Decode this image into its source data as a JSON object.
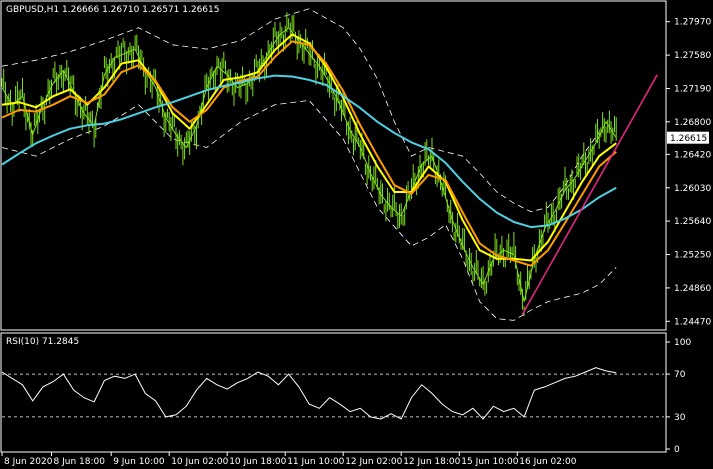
{
  "chart_data": {
    "type": "line",
    "main_panel": {
      "header": "GBPUSD,H1  1.26666 1.26710 1.26571 1.26615",
      "y_ticks": [
        "1.27970",
        "1.27580",
        "1.27190",
        "1.26800",
        "1.26420",
        "1.26030",
        "1.25640",
        "1.25250",
        "1.24860",
        "1.24470"
      ],
      "y_tick_values": [
        1.2797,
        1.2758,
        1.2719,
        1.268,
        1.2642,
        1.2603,
        1.2564,
        1.2525,
        1.2486,
        1.2447
      ],
      "ylim": [
        1.2438,
        1.282
      ],
      "current_price_label": "1.26615",
      "current_price": 1.26615,
      "price_series": [
        [
          0,
          1.272
        ],
        [
          6,
          1.27
        ],
        [
          12,
          1.271
        ],
        [
          18,
          1.2665
        ],
        [
          24,
          1.27
        ],
        [
          30,
          1.2725
        ],
        [
          36,
          1.274
        ],
        [
          42,
          1.2715
        ],
        [
          48,
          1.269
        ],
        [
          54,
          1.2675
        ],
        [
          60,
          1.2735
        ],
        [
          66,
          1.2755
        ],
        [
          72,
          1.276
        ],
        [
          78,
          1.2765
        ],
        [
          84,
          1.274
        ],
        [
          90,
          1.272
        ],
        [
          96,
          1.2685
        ],
        [
          102,
          1.2665
        ],
        [
          108,
          1.265
        ],
        [
          114,
          1.2675
        ],
        [
          120,
          1.272
        ],
        [
          126,
          1.2745
        ],
        [
          132,
          1.2735
        ],
        [
          138,
          1.272
        ],
        [
          144,
          1.2725
        ],
        [
          150,
          1.274
        ],
        [
          156,
          1.276
        ],
        [
          162,
          1.278
        ],
        [
          168,
          1.279
        ],
        [
          174,
          1.2775
        ],
        [
          180,
          1.276
        ],
        [
          186,
          1.2745
        ],
        [
          192,
          1.2725
        ],
        [
          198,
          1.27
        ],
        [
          204,
          1.267
        ],
        [
          210,
          1.265
        ],
        [
          216,
          1.262
        ],
        [
          222,
          1.2595
        ],
        [
          228,
          1.258
        ],
        [
          234,
          1.257
        ],
        [
          240,
          1.26
        ],
        [
          246,
          1.263
        ],
        [
          252,
          1.264
        ],
        [
          258,
          1.2605
        ],
        [
          264,
          1.2565
        ],
        [
          270,
          1.2535
        ],
        [
          276,
          1.251
        ],
        [
          282,
          1.249
        ],
        [
          288,
          1.252
        ],
        [
          294,
          1.253
        ],
        [
          300,
          1.2525
        ],
        [
          306,
          1.247
        ],
        [
          312,
          1.252
        ],
        [
          318,
          1.2555
        ],
        [
          324,
          1.2575
        ],
        [
          330,
          1.26
        ],
        [
          336,
          1.2615
        ],
        [
          342,
          1.2635
        ],
        [
          348,
          1.2655
        ],
        [
          354,
          1.268
        ],
        [
          360,
          1.26615
        ]
      ],
      "series": [
        {
          "name": "ma_fast",
          "color": "#ffff00",
          "points": [
            [
              0,
              1.27
            ],
            [
              10,
              1.2703
            ],
            [
              20,
              1.2697
            ],
            [
              30,
              1.271
            ],
            [
              40,
              1.2718
            ],
            [
              50,
              1.27
            ],
            [
              60,
              1.272
            ],
            [
              70,
              1.2748
            ],
            [
              80,
              1.2752
            ],
            [
              90,
              1.2727
            ],
            [
              100,
              1.269
            ],
            [
              110,
              1.2672
            ],
            [
              120,
              1.27
            ],
            [
              130,
              1.2729
            ],
            [
              140,
              1.2732
            ],
            [
              150,
              1.2738
            ],
            [
              160,
              1.2764
            ],
            [
              170,
              1.2782
            ],
            [
              180,
              1.2772
            ],
            [
              190,
              1.2744
            ],
            [
              200,
              1.2708
            ],
            [
              210,
              1.2665
            ],
            [
              220,
              1.2628
            ],
            [
              230,
              1.2598
            ],
            [
              240,
              1.2598
            ],
            [
              250,
              1.2628
            ],
            [
              260,
              1.261
            ],
            [
              270,
              1.2565
            ],
            [
              280,
              1.253
            ],
            [
              290,
              1.252
            ],
            [
              300,
              1.252
            ],
            [
              310,
              1.2518
            ],
            [
              320,
              1.254
            ],
            [
              330,
              1.2575
            ],
            [
              340,
              1.261
            ],
            [
              350,
              1.264
            ],
            [
              360,
              1.2655
            ]
          ]
        },
        {
          "name": "ma_medium",
          "color": "#ff9900",
          "points": [
            [
              0,
              1.2685
            ],
            [
              10,
              1.2694
            ],
            [
              20,
              1.2692
            ],
            [
              30,
              1.27
            ],
            [
              40,
              1.271
            ],
            [
              50,
              1.2702
            ],
            [
              60,
              1.2712
            ],
            [
              70,
              1.2738
            ],
            [
              80,
              1.2746
            ],
            [
              90,
              1.2728
            ],
            [
              100,
              1.2697
            ],
            [
              110,
              1.268
            ],
            [
              120,
              1.2694
            ],
            [
              130,
              1.272
            ],
            [
              140,
              1.2728
            ],
            [
              150,
              1.2733
            ],
            [
              160,
              1.2756
            ],
            [
              170,
              1.2774
            ],
            [
              180,
              1.277
            ],
            [
              190,
              1.2748
            ],
            [
              200,
              1.2716
            ],
            [
              210,
              1.2676
            ],
            [
              220,
              1.264
            ],
            [
              230,
              1.2606
            ],
            [
              240,
              1.2596
            ],
            [
              250,
              1.2618
            ],
            [
              260,
              1.2612
            ],
            [
              270,
              1.2574
            ],
            [
              280,
              1.2538
            ],
            [
              290,
              1.2524
            ],
            [
              300,
              1.2518
            ],
            [
              310,
              1.2512
            ],
            [
              320,
              1.253
            ],
            [
              330,
              1.2562
            ],
            [
              340,
              1.2595
            ],
            [
              350,
              1.2628
            ],
            [
              360,
              1.2645
            ]
          ]
        },
        {
          "name": "ma_slow",
          "color": "#4dd0e1",
          "points": [
            [
              0,
              1.263
            ],
            [
              10,
              1.2643
            ],
            [
              20,
              1.2655
            ],
            [
              30,
              1.2664
            ],
            [
              40,
              1.2672
            ],
            [
              50,
              1.2676
            ],
            [
              60,
              1.2678
            ],
            [
              70,
              1.2683
            ],
            [
              80,
              1.269
            ],
            [
              90,
              1.2697
            ],
            [
              100,
              1.2703
            ],
            [
              110,
              1.271
            ],
            [
              120,
              1.2717
            ],
            [
              130,
              1.2722
            ],
            [
              140,
              1.2726
            ],
            [
              150,
              1.2731
            ],
            [
              160,
              1.2734
            ],
            [
              170,
              1.2733
            ],
            [
              180,
              1.2729
            ],
            [
              190,
              1.2723
            ],
            [
              200,
              1.271
            ],
            [
              210,
              1.2696
            ],
            [
              220,
              1.268
            ],
            [
              230,
              1.2667
            ],
            [
              240,
              1.2656
            ],
            [
              250,
              1.2648
            ],
            [
              260,
              1.2632
            ],
            [
              270,
              1.261
            ],
            [
              280,
              1.259
            ],
            [
              290,
              1.2574
            ],
            [
              300,
              1.2563
            ],
            [
              310,
              1.2557
            ],
            [
              320,
              1.2559
            ],
            [
              330,
              1.2567
            ],
            [
              340,
              1.2578
            ],
            [
              350,
              1.2592
            ],
            [
              360,
              1.2603
            ]
          ]
        }
      ],
      "envelope_upper": [
        [
          0,
          1.2745
        ],
        [
          20,
          1.2752
        ],
        [
          40,
          1.2762
        ],
        [
          60,
          1.2775
        ],
        [
          80,
          1.279
        ],
        [
          100,
          1.277
        ],
        [
          120,
          1.2765
        ],
        [
          140,
          1.2775
        ],
        [
          160,
          1.28
        ],
        [
          180,
          1.2812
        ],
        [
          200,
          1.279
        ],
        [
          210,
          1.2765
        ],
        [
          220,
          1.273
        ],
        [
          230,
          1.268
        ],
        [
          240,
          1.264
        ],
        [
          250,
          1.265
        ],
        [
          260,
          1.2645
        ],
        [
          270,
          1.264
        ],
        [
          280,
          1.262
        ],
        [
          290,
          1.2598
        ],
        [
          300,
          1.2585
        ],
        [
          310,
          1.2575
        ],
        [
          320,
          1.258
        ],
        [
          330,
          1.2605
        ],
        [
          340,
          1.264
        ],
        [
          350,
          1.2668
        ]
      ],
      "envelope_lower": [
        [
          0,
          1.265
        ],
        [
          20,
          1.264
        ],
        [
          40,
          1.266
        ],
        [
          60,
          1.2675
        ],
        [
          80,
          1.27
        ],
        [
          100,
          1.266
        ],
        [
          120,
          1.265
        ],
        [
          140,
          1.268
        ],
        [
          160,
          1.27
        ],
        [
          180,
          1.2705
        ],
        [
          200,
          1.266
        ],
        [
          220,
          1.258
        ],
        [
          240,
          1.2535
        ],
        [
          250,
          1.2545
        ],
        [
          260,
          1.256
        ],
        [
          270,
          1.252
        ],
        [
          280,
          1.247
        ],
        [
          290,
          1.245
        ],
        [
          300,
          1.2448
        ],
        [
          310,
          1.246
        ],
        [
          320,
          1.247
        ],
        [
          330,
          1.2475
        ],
        [
          340,
          1.248
        ],
        [
          350,
          1.249
        ],
        [
          360,
          1.251
        ]
      ],
      "trendline": {
        "color": "#e0267f",
        "from": [
          305,
          1.2455
        ],
        "to": [
          384,
          1.2735
        ]
      }
    },
    "rsi_panel": {
      "label": "RSI(10) 71.2845",
      "y_ticks": [
        "100",
        "70",
        "30",
        "0"
      ],
      "y_tick_values": [
        100,
        70,
        30,
        0
      ],
      "levels": [
        70,
        30
      ],
      "values": [
        [
          0,
          72
        ],
        [
          6,
          66
        ],
        [
          12,
          60
        ],
        [
          18,
          45
        ],
        [
          24,
          58
        ],
        [
          30,
          63
        ],
        [
          36,
          70
        ],
        [
          42,
          55
        ],
        [
          48,
          48
        ],
        [
          54,
          44
        ],
        [
          60,
          64
        ],
        [
          66,
          68
        ],
        [
          72,
          66
        ],
        [
          78,
          70
        ],
        [
          84,
          52
        ],
        [
          90,
          45
        ],
        [
          96,
          30
        ],
        [
          102,
          32
        ],
        [
          108,
          40
        ],
        [
          114,
          55
        ],
        [
          120,
          66
        ],
        [
          126,
          60
        ],
        [
          132,
          56
        ],
        [
          138,
          62
        ],
        [
          144,
          66
        ],
        [
          150,
          72
        ],
        [
          156,
          68
        ],
        [
          162,
          60
        ],
        [
          168,
          70
        ],
        [
          174,
          58
        ],
        [
          180,
          42
        ],
        [
          186,
          38
        ],
        [
          192,
          48
        ],
        [
          198,
          42
        ],
        [
          204,
          35
        ],
        [
          210,
          38
        ],
        [
          216,
          30
        ],
        [
          222,
          28
        ],
        [
          228,
          33
        ],
        [
          234,
          28
        ],
        [
          240,
          48
        ],
        [
          246,
          60
        ],
        [
          252,
          52
        ],
        [
          258,
          42
        ],
        [
          264,
          35
        ],
        [
          270,
          32
        ],
        [
          276,
          38
        ],
        [
          282,
          28
        ],
        [
          288,
          40
        ],
        [
          294,
          35
        ],
        [
          300,
          38
        ],
        [
          306,
          30
        ],
        [
          312,
          55
        ],
        [
          318,
          58
        ],
        [
          324,
          62
        ],
        [
          330,
          66
        ],
        [
          336,
          68
        ],
        [
          342,
          72
        ],
        [
          348,
          76
        ],
        [
          354,
          73
        ],
        [
          360,
          71.2845
        ]
      ]
    },
    "x_ticks": [
      {
        "label": "8 Jun 2020",
        "x": 0
      },
      {
        "label": "8 Jun 18:00",
        "x": 29
      },
      {
        "label": "9 Jun 10:00",
        "x": 64
      },
      {
        "label": "10 Jun 02:00",
        "x": 98
      },
      {
        "label": "10 Jun 18:00",
        "x": 132
      },
      {
        "label": "11 Jun 10:00",
        "x": 166
      },
      {
        "label": "12 Jun 02:00",
        "x": 200
      },
      {
        "label": "12 Jun 18:00",
        "x": 234
      },
      {
        "label": "15 Jun 10:00",
        "x": 268
      },
      {
        "label": "16 Jun 02:00",
        "x": 302
      }
    ],
    "xlim": [
      0,
      388
    ]
  },
  "colors": {
    "background": "#000000",
    "foreground": "#ffffff",
    "candles": "#7fe01e",
    "grid_dashed": "#ffffff",
    "price_label_bg": "#ffffff",
    "price_label_fg": "#000000"
  }
}
